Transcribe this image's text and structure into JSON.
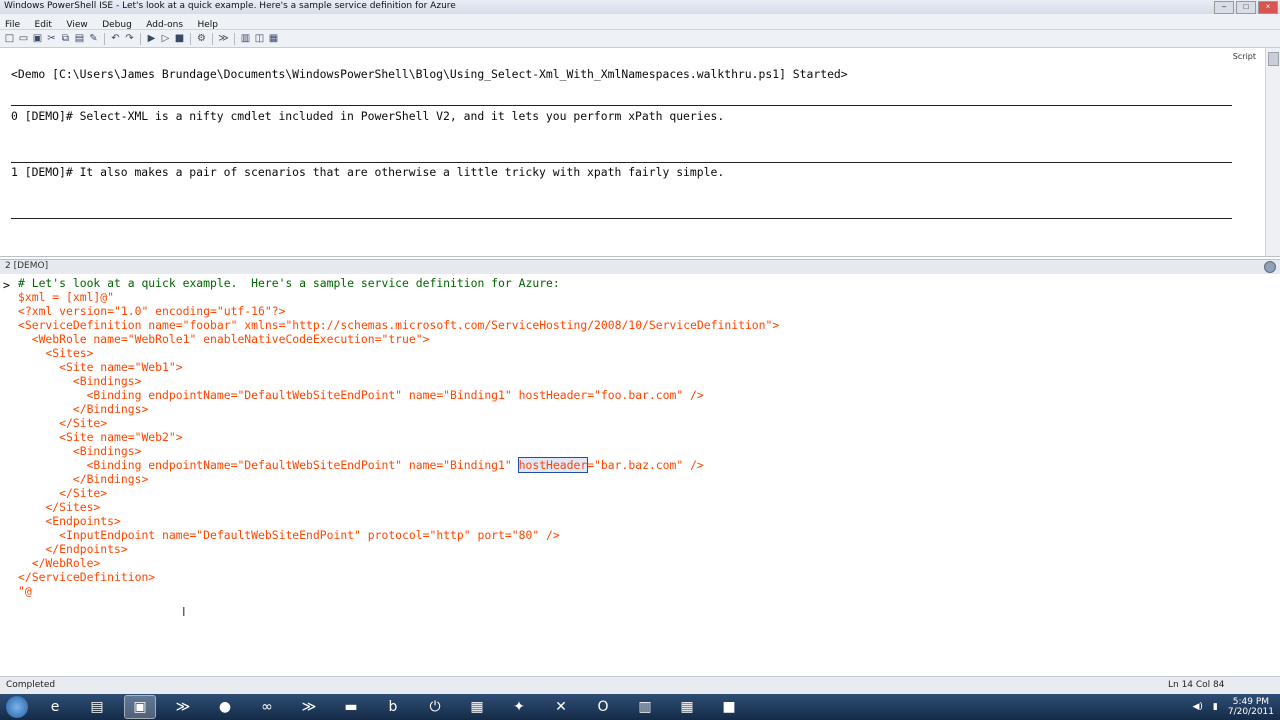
{
  "window": {
    "title": "Windows PowerShell ISE - Let's look at a quick example.  Here's a sample service definition for Azure"
  },
  "menu": [
    "File",
    "Edit",
    "View",
    "Debug",
    "Add-ons",
    "Help"
  ],
  "script_toggle": "Script",
  "output_lines": [
    "<Demo [C:\\Users\\James Brundage\\Documents\\WindowsPowerShell\\Blog\\Using_Select-Xml_With_XmlNamespaces.walkthru.ps1] Started>",
    "0 [DEMO]# Select-XML is a nifty cmdlet included in PowerShell V2, and it lets you perform xPath queries.",
    "1 [DEMO]# It also makes a pair of scenarios that are otherwise a little tricky with xpath fairly simple."
  ],
  "command_pane": {
    "header": "2 [DEMO]",
    "prompt": ">",
    "lines": [
      "# Let's look at a quick example.  Here's a sample service definition for Azure:",
      "$xml = [xml]@\"",
      "<?xml version=\"1.0\" encoding=\"utf-16\"?>",
      "<ServiceDefinition name=\"foobar\" xmlns=\"http://schemas.microsoft.com/ServiceHosting/2008/10/ServiceDefinition\">",
      "  <WebRole name=\"WebRole1\" enableNativeCodeExecution=\"true\">",
      "    <Sites>",
      "      <Site name=\"Web1\">",
      "        <Bindings>",
      "          <Binding endpointName=\"DefaultWebSiteEndPoint\" name=\"Binding1\" hostHeader=\"foo.bar.com\" />",
      "        </Bindings>",
      "      </Site>",
      "      <Site name=\"Web2\">",
      "        <Bindings>",
      "          <Binding endpointName=\"DefaultWebSiteEndPoint\" name=\"Binding1\" ",
      "        </Bindings>",
      "      </Site>",
      "    </Sites>",
      "    <Endpoints>",
      "      <InputEndpoint name=\"DefaultWebSiteEndPoint\" protocol=\"http\" port=\"80\" />",
      "    </Endpoints>",
      "  </WebRole>",
      "</ServiceDefinition>",
      "\"@"
    ],
    "highlight_word": "hostHeader",
    "line13_tail": "=\"bar.baz.com\" />"
  },
  "status": {
    "text": "Completed",
    "position": "Ln 14  Col 84"
  },
  "clock": {
    "time": "5:49 PM",
    "date": "7/20/2011"
  },
  "taskbar_icons": [
    "start-orb-icon",
    "internet-explorer-icon",
    "explorer-folder-icon",
    "powershell-ise-icon",
    "powershell-icon",
    "firefox-icon",
    "visual-studio-icon",
    "powershell-icon",
    "console-icon",
    "bing-icon",
    "power-icon",
    "network-icon",
    "tool-icon",
    "settings-icon",
    "outlook-icon",
    "chart-icon",
    "spreadsheet-icon",
    "app-icon"
  ]
}
